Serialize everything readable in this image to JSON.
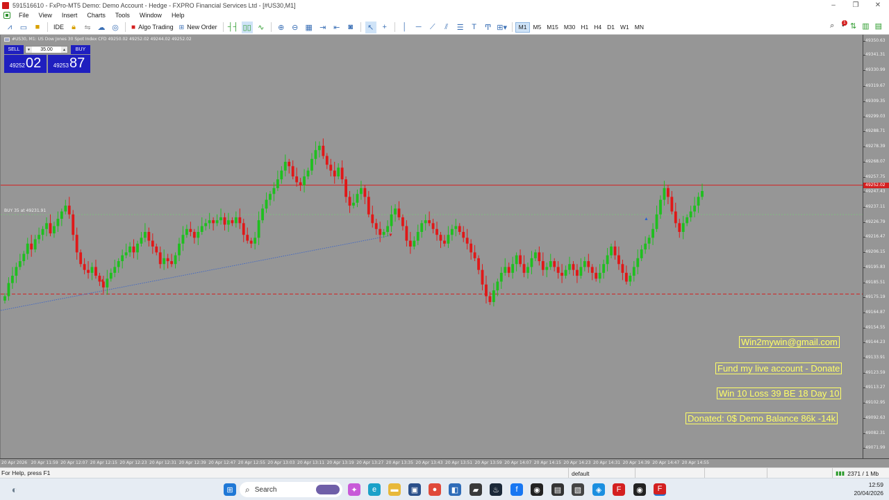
{
  "window": {
    "title": "591516610 - FxPro-MT5 Demo: Demo Account - Hedge - FXPRO Financial Services Ltd - [#US30,M1]",
    "controls": [
      "–",
      "❐",
      "✕"
    ]
  },
  "menu": [
    "File",
    "View",
    "Insert",
    "Charts",
    "Tools",
    "Window",
    "Help"
  ],
  "toolbar": {
    "ide_label": "IDE",
    "algo_trading_label": "Algo Trading",
    "new_order_label": "New Order",
    "timeframes": [
      "M1",
      "M5",
      "M15",
      "M30",
      "H1",
      "H4",
      "D1",
      "W1",
      "MN"
    ],
    "active_timeframe": "M1",
    "notification_count": "1"
  },
  "chart": {
    "symbol_info": "#US30, M1: US Dow Jones 30 Spot Index CFD  49250.02 49252.02 49244.02 49252.02",
    "trade_panel": {
      "sell_label": "SELL",
      "buy_label": "BUY",
      "lot": "35.00",
      "sell_price_small": "49252",
      "sell_price_big": "02",
      "buy_price_small": "49253",
      "buy_price_big": "87"
    },
    "position_label": "BUY 35 at 49231.91",
    "price_axis": [
      "49350.63",
      "49341.31",
      "49330.99",
      "49319.67",
      "49309.35",
      "49299.03",
      "49288.71",
      "49278.39",
      "49268.07",
      "49257.75",
      "49247.43",
      "49237.11",
      "49226.79",
      "49216.47",
      "49206.15",
      "49195.83",
      "49185.51",
      "49175.19",
      "49164.87",
      "49154.55",
      "49144.23",
      "49133.91",
      "49123.59",
      "49113.27",
      "49102.95",
      "49092.63",
      "49082.31",
      "49071.99"
    ],
    "time_axis": [
      "20 Apr 2026",
      "20 Apr 11:59",
      "20 Apr 12:07",
      "20 Apr 12:15",
      "20 Apr 12:23",
      "20 Apr 12:31",
      "20 Apr 12:39",
      "20 Apr 12:47",
      "20 Apr 12:55",
      "20 Apr 13:03",
      "20 Apr 13:11",
      "20 Apr 13:19",
      "20 Apr 13:27",
      "20 Apr 13:35",
      "20 Apr 13:43",
      "20 Apr 13:51",
      "20 Apr 13:59",
      "20 Apr 14:07",
      "20 Apr 14:15",
      "20 Apr 14:23",
      "20 Apr 14:31",
      "20 Apr 14:39",
      "20 Apr 14:47",
      "20 Apr 14:55"
    ],
    "bid_line_price": 49252.02,
    "position_price": 49231.91,
    "stop_line_price": 49177.5,
    "colors": {
      "background": "#969696",
      "bull": "#1fbf1f",
      "bear": "#e01818",
      "doji": "#e8e850",
      "bid_line": "#d42020",
      "stop_line": "#d42020",
      "position_line": "#7fbf7f",
      "trend_line": "#3a64c8",
      "annotation": "#ffff66"
    },
    "annotations": [
      "Win2mywin@gmail.com",
      "Fund my live account - Donate",
      "Win 10  Loss 39  BE 18  Day 10",
      "Donated: 0$  Demo Balance 86k -14k"
    ]
  },
  "chart_data": {
    "type": "candlestick",
    "y_range": [
      49065,
      49355
    ],
    "closes": [
      49176,
      49185,
      49190,
      49196,
      49200,
      49205,
      49212,
      49208,
      49215,
      49218,
      49222,
      49226,
      49219,
      49224,
      49229,
      49234,
      49238,
      49232,
      49218,
      49206,
      49198,
      49194,
      49192,
      49196,
      49190,
      49186,
      49182,
      49188,
      49192,
      49196,
      49200,
      49204,
      49206,
      49210,
      49206,
      49212,
      49216,
      49220,
      49214,
      49210,
      49206,
      49198,
      49202,
      49200,
      49198,
      49204,
      49212,
      49218,
      49222,
      49220,
      49216,
      49220,
      49224,
      49226,
      49228,
      49226,
      49228,
      49230,
      49225,
      49228,
      49226,
      49230,
      49226,
      49218,
      49214,
      49212,
      49216,
      49228,
      49236,
      49242,
      49246,
      49250,
      49256,
      49262,
      49268,
      49265,
      49258,
      49254,
      49252,
      49258,
      49262,
      49270,
      49276,
      49279,
      49272,
      49266,
      49262,
      49258,
      49264,
      49256,
      49244,
      49238,
      49240,
      49246,
      49250,
      49244,
      49232,
      49226,
      49222,
      49218,
      49220,
      49224,
      49232,
      49236,
      49230,
      49224,
      49214,
      49210,
      49214,
      49220,
      49226,
      49228,
      49226,
      49222,
      49218,
      49214,
      49212,
      49218,
      49222,
      49224,
      49220,
      49216,
      49212,
      49206,
      49202,
      49194,
      49184,
      49176,
      49172,
      49180,
      49186,
      49192,
      49196,
      49192,
      49198,
      49204,
      49198,
      49192,
      49196,
      49202,
      49206,
      49200,
      49194,
      49196,
      49200,
      49196,
      49192,
      49190,
      49194,
      49198,
      49194,
      49190,
      49196,
      49200,
      49196,
      49192,
      49188,
      49192,
      49198,
      49204,
      49210,
      49204,
      49198,
      49192,
      49186,
      49190,
      49196,
      49202,
      49208,
      49212,
      49216,
      49222,
      49232,
      49242,
      49250,
      49244,
      49234,
      49226,
      49220,
      49226,
      49230,
      49234,
      49238,
      49244,
      49248
    ]
  },
  "status": {
    "help_text": "For Help, press F1",
    "profile": "default",
    "traffic": "2371 / 1 Mb"
  },
  "taskbar": {
    "search_placeholder": "Search",
    "time": "12:59",
    "date": "20/04/2026"
  }
}
